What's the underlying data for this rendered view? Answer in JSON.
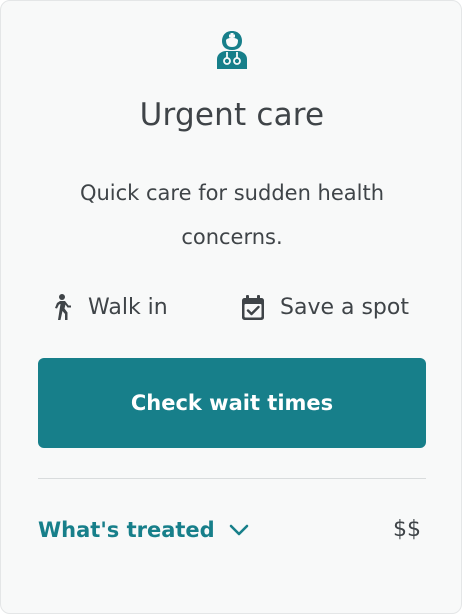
{
  "card": {
    "icon": "doctor-icon",
    "title": "Urgent care",
    "description": "Quick care for sudden health concerns.",
    "options": [
      {
        "icon": "walking-person-icon",
        "label": "Walk in"
      },
      {
        "icon": "calendar-check-icon",
        "label": "Save a spot"
      }
    ],
    "cta_label": "Check wait times",
    "whats_treated_label": "What's treated",
    "price": "$$"
  },
  "colors": {
    "accent": "#177f8a",
    "text": "#3f4448",
    "card_bg": "#f8f9f9"
  }
}
